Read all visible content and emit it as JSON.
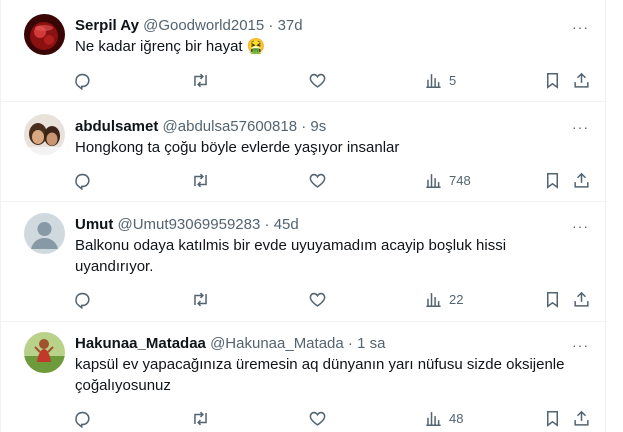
{
  "tweets": [
    {
      "name": "Serpil Ay",
      "handle": "@Goodworld2015",
      "time": "37d",
      "text": "Ne kadar iğrenç bir hayat",
      "emoji": "🤮",
      "views": "5",
      "avatar_color": "#8b1010"
    },
    {
      "name": "abdulsamet",
      "handle": "@abdulsa57600818",
      "time": "9s",
      "text": "Hongkong ta çoğu böyle evlerde yaşıyor insanlar",
      "views": "748",
      "avatar_color": "#c9a27a"
    },
    {
      "name": "Umut",
      "handle": "@Umut93069959283",
      "time": "45d",
      "text": "Balkonu odaya katılmis bir evde uyuyamadım acayip boşluk hissi uyandırıyor.",
      "views": "22",
      "avatar_color": "#cfd9de"
    },
    {
      "name": "Hakunaa_Matadaa",
      "handle": "@Hakunaa_Matada",
      "time": "1 sa",
      "text": "kapsül ev yapacağınıza üremesin aq dünyanın yarı nüfusu sizde oksijenle çoğalıyosunuz",
      "views": "48",
      "avatar_color": "#7fa14a"
    }
  ],
  "dot": "·",
  "more_label": "···"
}
